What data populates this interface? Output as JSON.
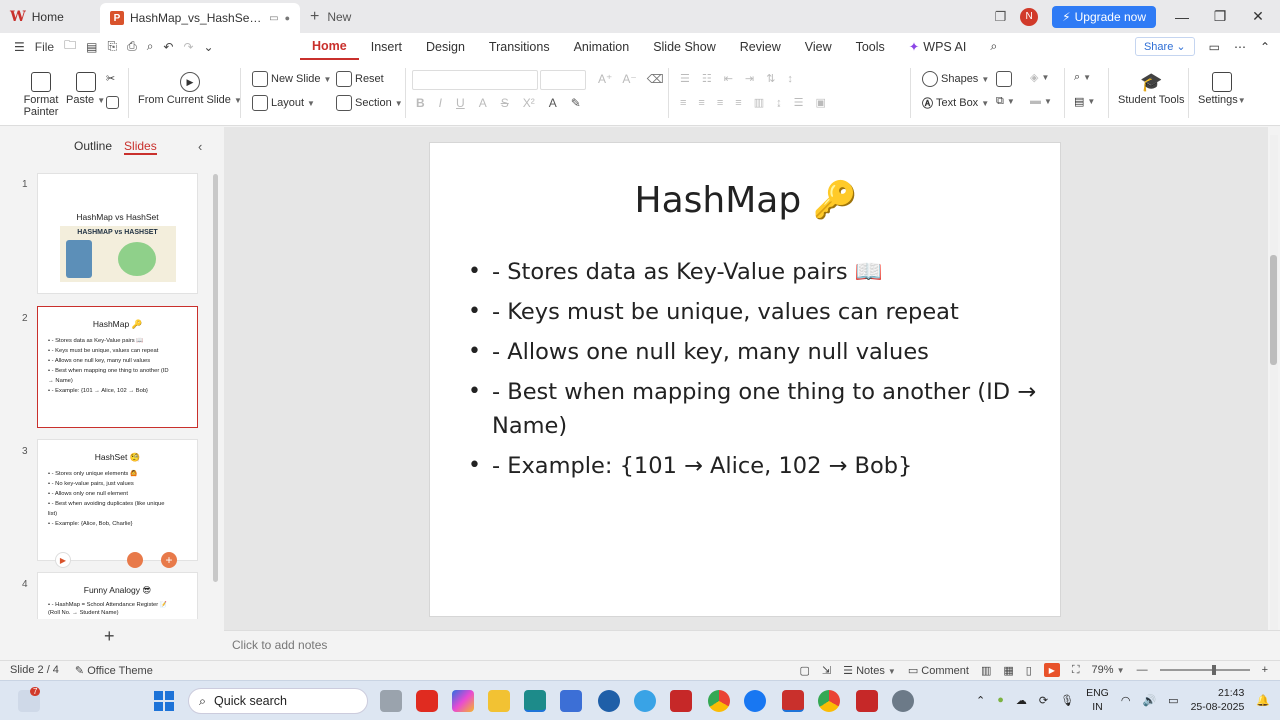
{
  "tabs": {
    "home_label": "Home",
    "doc_title": "HashMap_vs_HashSet_Funny.p",
    "new_label": "New",
    "avatar_letter": "N",
    "upgrade_label": "Upgrade now"
  },
  "menu": {
    "file_label": "File",
    "tabs": [
      "Home",
      "Insert",
      "Design",
      "Transitions",
      "Animation",
      "Slide Show",
      "Review",
      "View",
      "Tools"
    ],
    "active_tab": "Home",
    "wps_ai_label": "WPS AI",
    "share_label": "Share"
  },
  "ribbon": {
    "format_painter": "Format Painter",
    "paste": "Paste",
    "from_current_slide": "From Current Slide",
    "new_slide": "New Slide",
    "reset": "Reset",
    "layout": "Layout",
    "section": "Section",
    "shapes": "Shapes",
    "text_box": "Text Box",
    "student_tools": "Student Tools",
    "settings": "Settings"
  },
  "pane": {
    "outline_label": "Outline",
    "slides_label": "Slides"
  },
  "thumbnails": [
    {
      "num": "1",
      "title": "HashMap vs HashSet",
      "image_caption": "HASHMAP vs HASHSET"
    },
    {
      "num": "2",
      "title": "HashMap 🔑",
      "lines": [
        "• - Stores data as Key-Value pairs 📖",
        "• - Keys must be unique, values can repeat",
        "• - Allows one null key, many null values",
        "• - Best when mapping one thing to another (ID",
        "   → Name)",
        "• - Example: {101 → Alice, 102 → Bob}"
      ]
    },
    {
      "num": "3",
      "title": "HashSet 🧐",
      "lines": [
        "• - Stores only unique elements 🙆",
        "• - No key-value pairs, just values",
        "• - Allows only one null element",
        "• - Best when avoiding duplicates (like unique",
        "   list)",
        "• - Example: {Alice, Bob, Charlie}"
      ]
    },
    {
      "num": "4",
      "title": "Funny Analogy 😎",
      "lines": [
        "• - HashMap = School Attendance Register 📝",
        "   (Roll No. → Student Name)"
      ]
    }
  ],
  "slide": {
    "title": "HashMap 🔑",
    "bullets": [
      "- Stores data as Key-Value pairs 📖",
      "- Keys must be unique, values can repeat",
      "- Allows one null key, many null values",
      "- Best when mapping one thing to another (ID → Name)",
      "- Example: {101 → Alice, 102 → Bob}"
    ]
  },
  "notes_placeholder": "Click to add notes",
  "status": {
    "slide_count": "Slide 2 / 4",
    "theme": "Office Theme",
    "notes_label": "Notes",
    "comment_label": "Comment",
    "zoom": "79%"
  },
  "taskbar": {
    "search_label": "Quick search",
    "lang_top": "ENG",
    "lang_bottom": "IN",
    "time": "21:43",
    "date": "25-08-2025",
    "weather_badge": "7"
  }
}
